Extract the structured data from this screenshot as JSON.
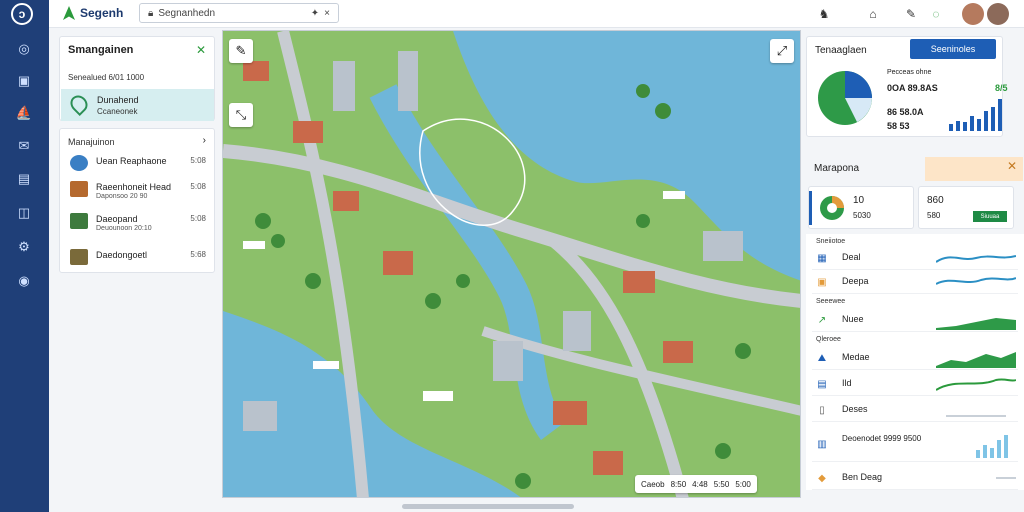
{
  "rail": {
    "items": [
      "home-icon",
      "document-icon",
      "ship-icon",
      "chat-icon",
      "calendar-icon",
      "package-icon",
      "settings-icon",
      "compass-icon"
    ]
  },
  "topbar": {
    "brand": "Segenh",
    "search_value": "Segnanhedn",
    "search_clear": "×"
  },
  "left_panel": {
    "title": "Smangainen",
    "close": "✕",
    "subtitle": "Senealued  6/01 1000",
    "selected": {
      "label": "Dunahend",
      "sub": "Ccaneonek"
    }
  },
  "layers": {
    "title": "Manajuinon",
    "toggle": "›",
    "items": [
      {
        "label": "Uean Reaphaone",
        "value": "5:08",
        "sub": ""
      },
      {
        "label": "Raeenhoneit Head",
        "value": "5:08",
        "sub": "Daponsoo 20 90"
      },
      {
        "label": "Daeopand",
        "value": "5:08",
        "sub": "Deuounoon 20:10"
      },
      {
        "label": "Daedongoetl",
        "value": "5:68",
        "sub": ""
      }
    ]
  },
  "map": {
    "footer": [
      "Caeob",
      "8:50",
      "4:48",
      "5:50",
      "5:00"
    ],
    "colors": {
      "water": "#6fb6d9",
      "land": "#8cc06a",
      "road": "#c8ccd2"
    }
  },
  "stats": {
    "title": "Tenaaglaen",
    "button": "Seeninoles",
    "caption": "Pecceas ohne",
    "lines": [
      "0OA 89.8AS",
      "86  58.0A",
      "58 53"
    ],
    "bar_label": "8/5",
    "bar_values": [
      0.2,
      0.3,
      0.25,
      0.45,
      0.35,
      0.6,
      0.7,
      0.95
    ]
  },
  "mapone": {
    "title": "Marapona",
    "close": "✕",
    "card1": {
      "value": "10",
      "sub": "5030"
    },
    "card2": {
      "value": "860",
      "sub": "580",
      "button": "Siuuaa"
    }
  },
  "list": {
    "groups": [
      "Sneiiotoe",
      "Seeewee",
      "Qleroee"
    ],
    "rows": [
      {
        "label": "Deal"
      },
      {
        "label": "Deepa"
      },
      {
        "label": "Nuee"
      },
      {
        "label": "Medae"
      },
      {
        "label": "Ild"
      },
      {
        "label": "Deses"
      },
      {
        "label": "Deoenodet  9999 9500"
      },
      {
        "label": "Ben Deag"
      }
    ]
  }
}
